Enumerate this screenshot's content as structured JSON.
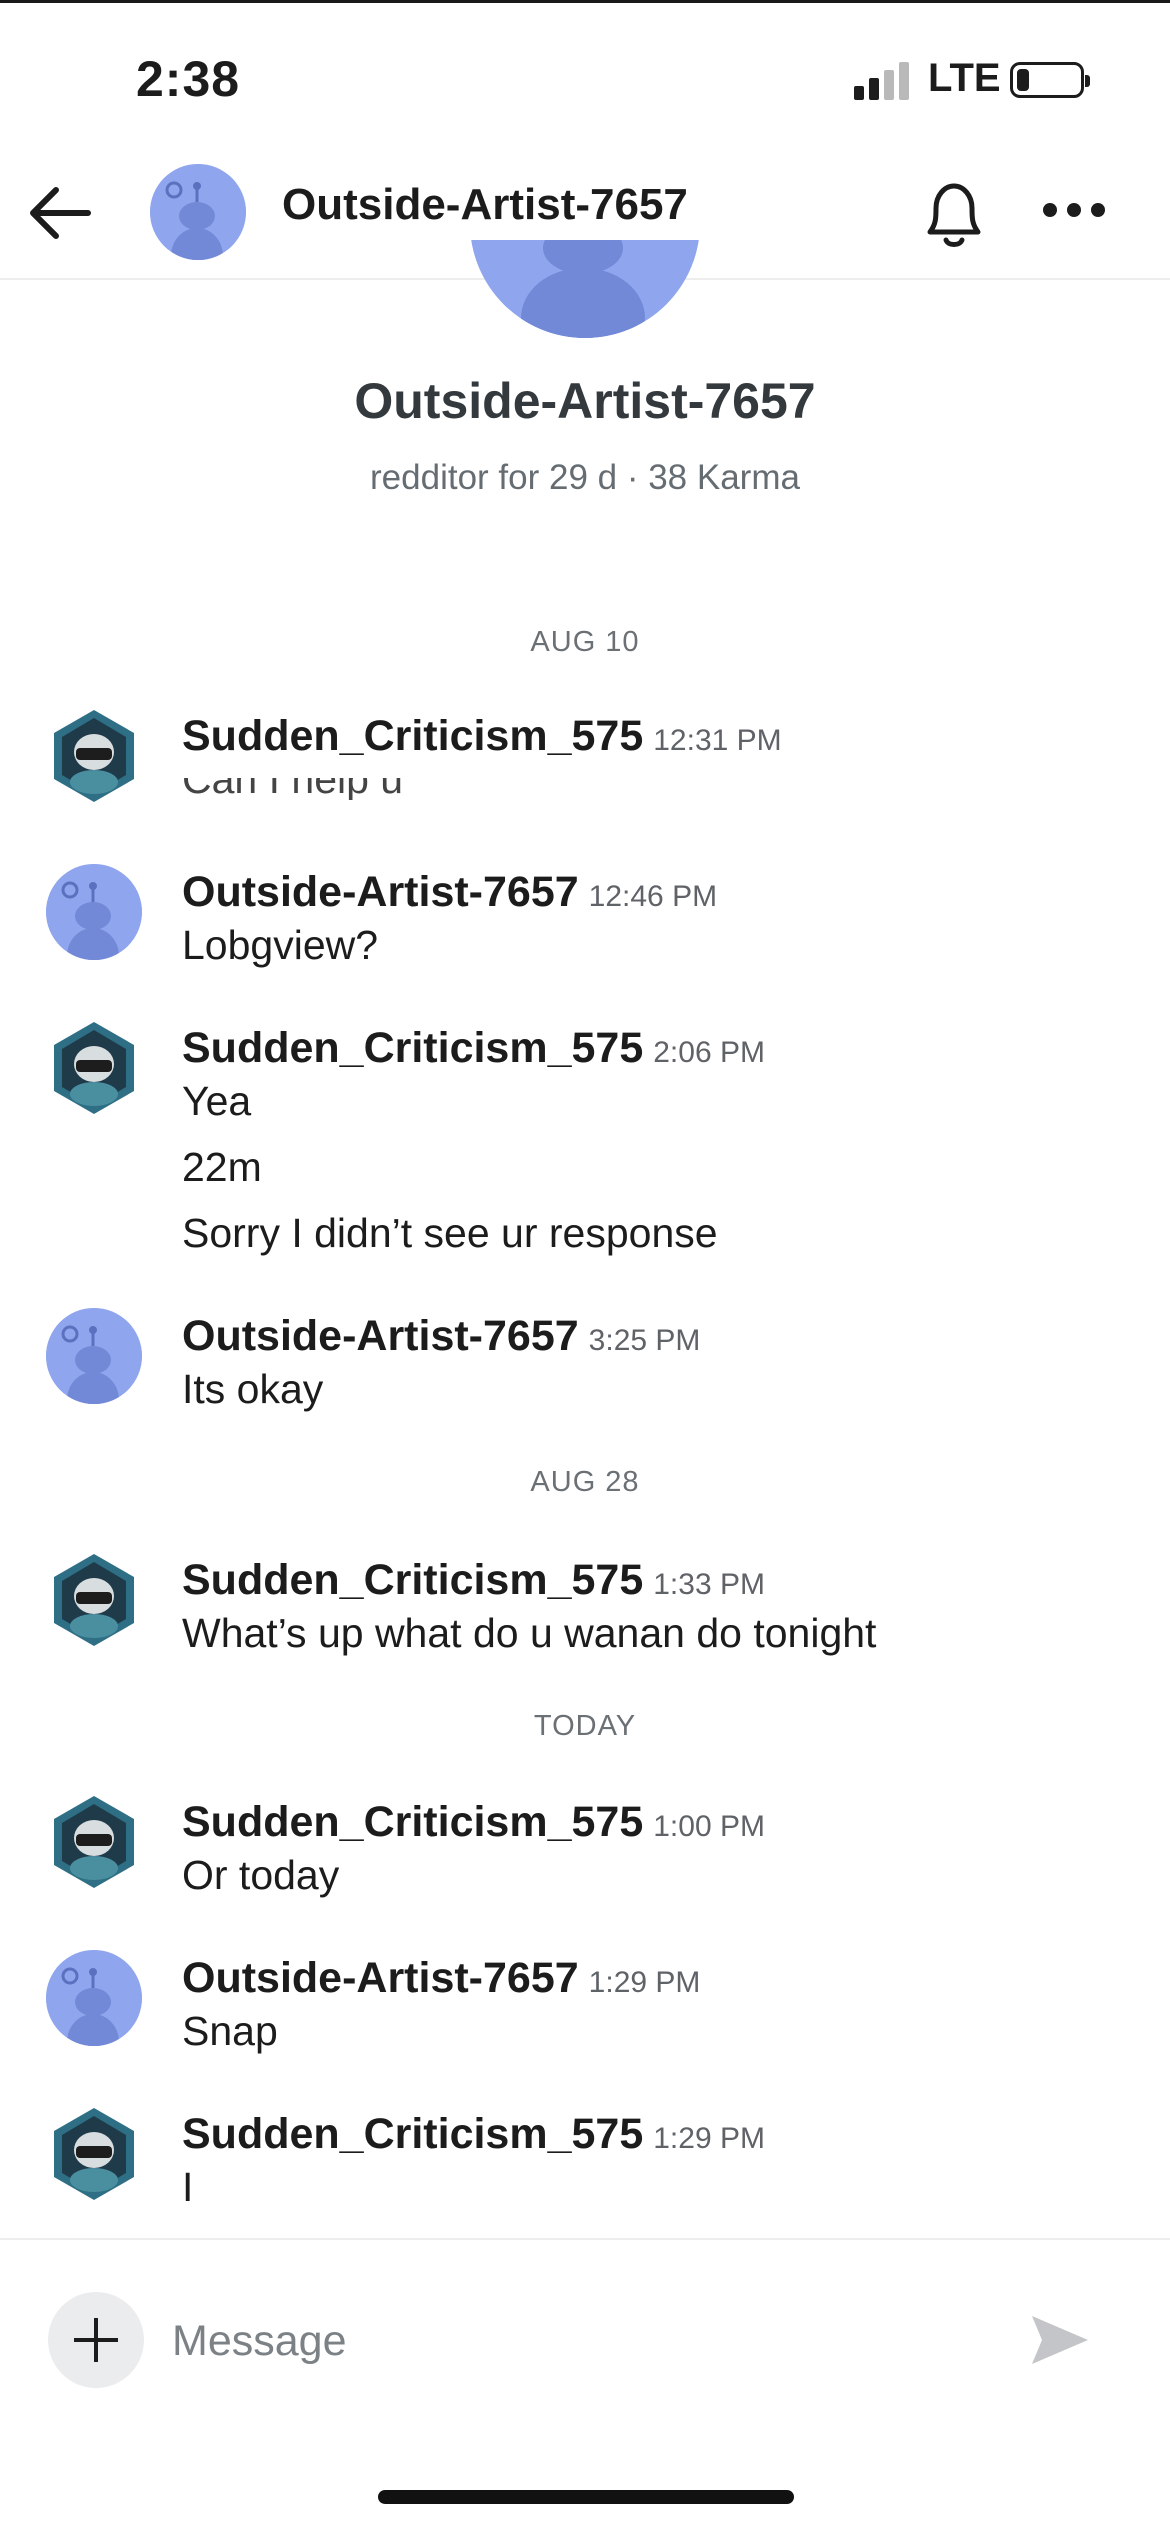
{
  "status_bar": {
    "time": "2:38",
    "network": "LTE"
  },
  "header": {
    "title": "Outside-Artist-7657"
  },
  "profile": {
    "name": "Outside-Artist-7657",
    "meta": "redditor for 29 d · 38 Karma"
  },
  "date_separators": [
    "AUG 10",
    "AUG 28",
    "TODAY"
  ],
  "messages": [
    {
      "author": "Sudden_Criticism_575",
      "time": "12:31 PM",
      "lines": [
        "Can I help u"
      ]
    },
    {
      "author": "Outside-Artist-7657",
      "time": "12:46 PM",
      "lines": [
        "Lobgview?"
      ]
    },
    {
      "author": "Sudden_Criticism_575",
      "time": "2:06 PM",
      "lines": [
        "Yea",
        "22m",
        "Sorry I didn’t see ur response"
      ]
    },
    {
      "author": "Outside-Artist-7657",
      "time": "3:25 PM",
      "lines": [
        "Its okay"
      ]
    },
    {
      "author": "Sudden_Criticism_575",
      "time": "1:33 PM",
      "lines": [
        "What’s up what do u wanan do tonight"
      ]
    },
    {
      "author": "Sudden_Criticism_575",
      "time": "1:00 PM",
      "lines": [
        "Or today"
      ]
    },
    {
      "author": "Outside-Artist-7657",
      "time": "1:29 PM",
      "lines": [
        "Snap"
      ]
    },
    {
      "author": "Sudden_Criticism_575",
      "time": "1:29 PM",
      "lines": [
        "I"
      ]
    }
  ],
  "composer": {
    "placeholder": "Message"
  },
  "icons": {
    "back": "back-arrow-icon",
    "bell": "bell-icon",
    "more": "more-horizontal-icon",
    "add": "plus-icon",
    "send": "send-icon"
  },
  "colors": {
    "snoo_avatar_bg": "#8fa6ee",
    "hex_avatar_bg": "#2f6f85",
    "accent_text": "#1c1c1c"
  }
}
